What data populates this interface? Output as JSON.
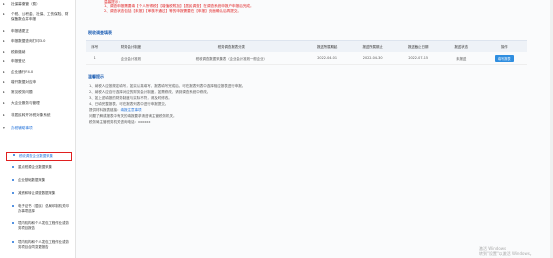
{
  "sidebar": {
    "items": [
      {
        "label": "社保募缴管（费）",
        "blue": false
      },
      {
        "label": "个税、公积金、社保、工伤保险、财保备数合并申报",
        "blue": false
      },
      {
        "label": "申报错更正",
        "blue": false
      },
      {
        "label": "申报数据查询打印3.0",
        "blue": false
      },
      {
        "label": "税款缴纳",
        "blue": false
      },
      {
        "label": "申报登记",
        "blue": false
      },
      {
        "label": "企业通行F4.0",
        "blue": false
      },
      {
        "label": "增开数据对应申",
        "blue": false
      },
      {
        "label": "常见税务问题",
        "blue": false
      },
      {
        "label": "大企业服务与管理",
        "blue": false
      },
      {
        "label": "非居民转开补税对象系统",
        "blue": false
      },
      {
        "label": "办税辅助事项",
        "blue": true
      }
    ],
    "subitems": [
      {
        "label": "税收调查企业数据采集",
        "active": true
      },
      {
        "label": "重点税源企业数据采集",
        "active": false
      },
      {
        "label": "企业基础数据采集",
        "active": false
      },
      {
        "label": "减资和转让调查数据采集",
        "active": false
      },
      {
        "label": "电子证书（居民）总局印制机关印办事项选择",
        "active": false
      },
      {
        "label": "境内机构和个人发包工程作业或劳务项目报告",
        "active": false
      },
      {
        "label": "境内机构和个人发包工程作业或劳务项目合同变更报告",
        "active": false
      }
    ]
  },
  "notice": {
    "label": "温馨提示：",
    "lines": [
      "1、调查申报需要填【个人所得税】【增值税附加】【居民调查】在调查系统申报户申报后完成。",
      "2、调查状态包括【未报】【审核不通过】等的申报需要在【申报】页面确认后再提交。"
    ]
  },
  "table_title": "税收调查填表",
  "table": {
    "headers": [
      "序号",
      "财务会计制度",
      "税务调查报表分类",
      "报送所属期起",
      "报送所属期止",
      "报送截止日期",
      "报送状态",
      "操作"
    ],
    "rows": [
      {
        "cells": [
          "1",
          "企业会计准则",
          "税收调查数据采集表（企业会计准则一般企业）",
          "2022-04-01",
          "2022-04-30",
          "2022-07-15",
          "未报送"
        ],
        "action": "填写报表"
      }
    ]
  },
  "tips_title": "温馨提示",
  "tips": {
    "lines": [
      "1、纳税人应按规定填写，如实认真填写，报表填写完成后，可在报表列表中选择相应报表进行申报。",
      "2、纳税人应自行选择对应的财务会计制度，如需修改，请到调查系统中修改。",
      "3、如上述填报的财务制度与实际不符，请及时修改。",
      "4、已填完整报表，可在报表列表中进行申报提交。"
    ],
    "extra": [
      "提供材料报表链接：",
      "问题了解或报表中有关的填报要求请咨询主管税务机关。",
      "税务局主管税务机关咨询电话：xxxxxx"
    ],
    "link_label": "填报注意事项"
  },
  "watermark": {
    "line1": "激活 Windows",
    "line2": "转到\"设置\"以激活 Windows。"
  }
}
